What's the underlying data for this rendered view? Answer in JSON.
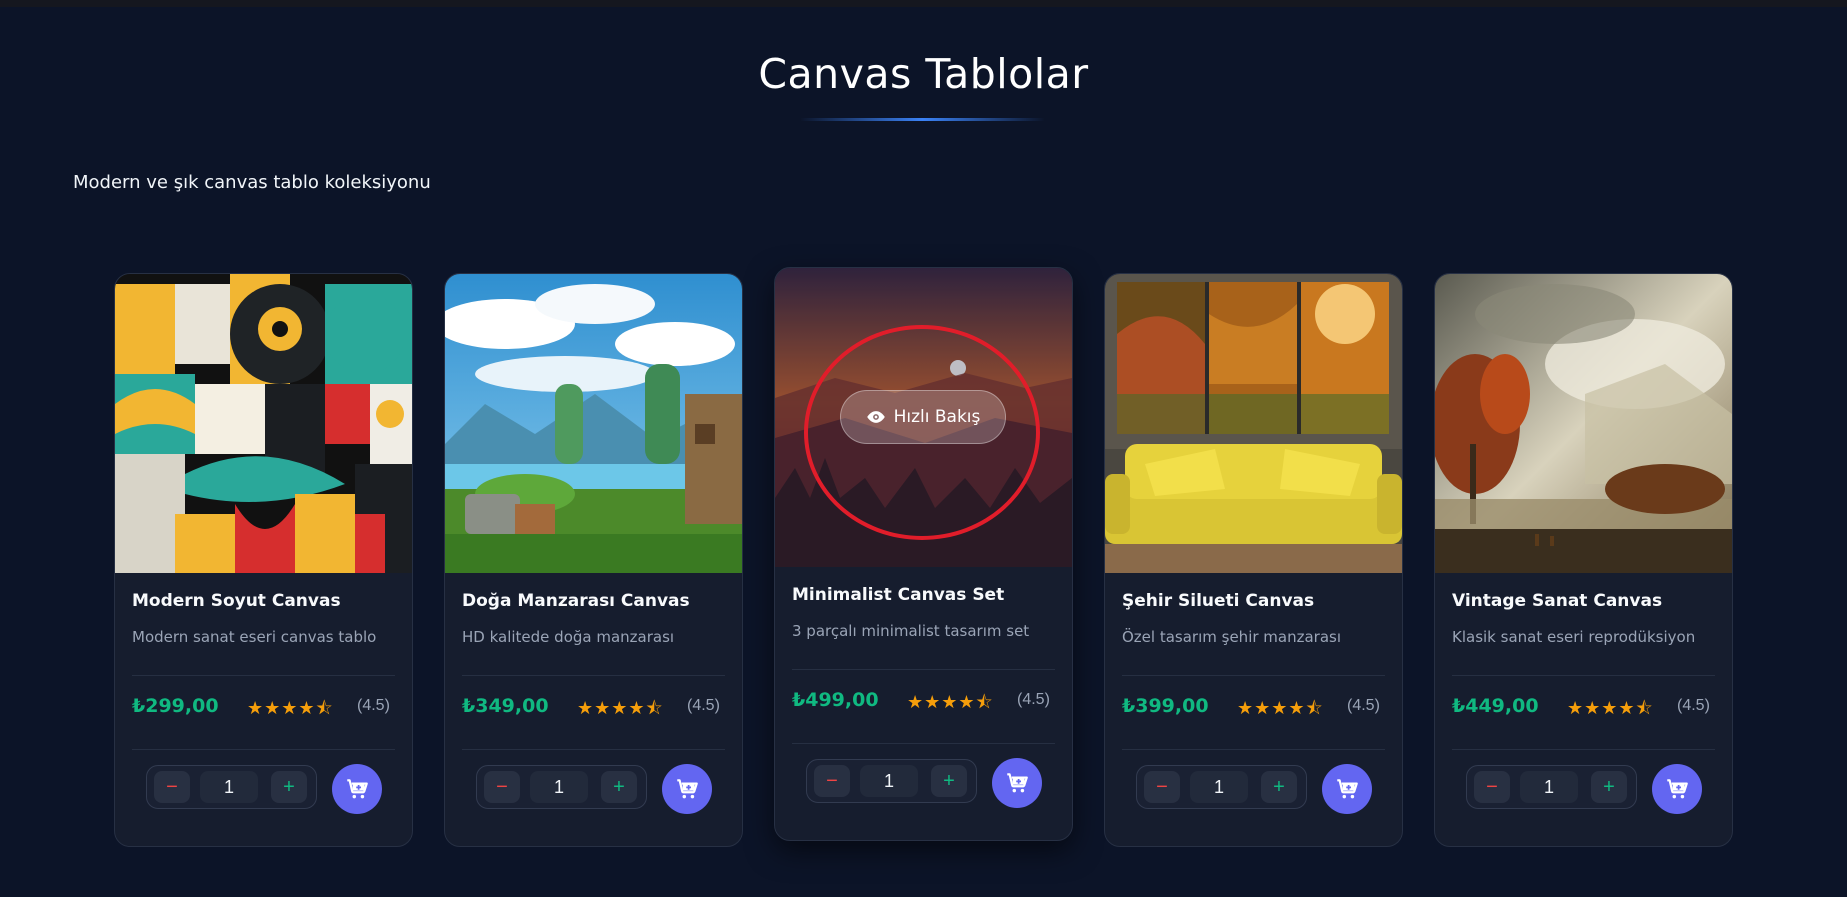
{
  "section": {
    "title": "Canvas Tablolar",
    "subtitle": "Modern ve şık canvas tablo koleksiyonu"
  },
  "quick_view_label": "Hızlı Bakış",
  "products": [
    {
      "name": "Modern Soyut Canvas",
      "description": "Modern sanat eseri canvas tablo",
      "price": "₺299,00",
      "rating": 4.5,
      "rating_text": "(4.5)",
      "quantity": "1"
    },
    {
      "name": "Doğa Manzarası Canvas",
      "description": "HD kalitede doğa manzarası",
      "price": "₺349,00",
      "rating": 4.5,
      "rating_text": "(4.5)",
      "quantity": "1"
    },
    {
      "name": "Minimalist Canvas Set",
      "description": "3 parçalı minimalist tasarım set",
      "price": "₺499,00",
      "rating": 4.5,
      "rating_text": "(4.5)",
      "quantity": "1"
    },
    {
      "name": "Şehir Silueti Canvas",
      "description": "Özel tasarım şehir manzarası",
      "price": "₺399,00",
      "rating": 4.5,
      "rating_text": "(4.5)",
      "quantity": "1"
    },
    {
      "name": "Vintage Sanat Canvas",
      "description": "Klasik sanat eseri reprodüksiyon",
      "price": "₺449,00",
      "rating": 4.5,
      "rating_text": "(4.5)",
      "quantity": "1"
    }
  ],
  "controls": {
    "minus": "−",
    "plus": "+"
  },
  "colors": {
    "background": "#0c1428",
    "card": "#161d2e",
    "price": "#10b981",
    "star": "#f59e0b",
    "cart_button": "#6366f1",
    "minus": "#ef4444",
    "plus": "#10b981",
    "highlight": "#e11d2a"
  },
  "icons": {
    "star": "star-icon",
    "half_star": "star-half-icon",
    "cart": "cart-plus-icon",
    "eye": "eye-icon"
  }
}
